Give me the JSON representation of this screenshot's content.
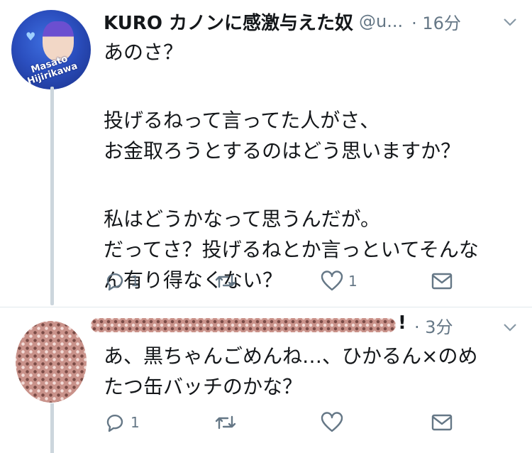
{
  "tweet1": {
    "author_name": "KURO カノンに感激与えた奴",
    "handle": "@u...",
    "time": "· 16分",
    "avatar_caption": "Masato Hijirikawa",
    "lines": [
      "あのさ？",
      "",
      "投げるねって言ってた人がさ、",
      "お金取ろうとするのはどう思いますか？",
      "",
      "私はどうかなって思うんだが。",
      "だってさ？投げるねとか言っといてそんな",
      "ん有り得なくない？"
    ],
    "actions": {
      "reply_count": "1",
      "retweet_count": "",
      "like_count": "1"
    }
  },
  "tweet2": {
    "author_suffix": "!",
    "time": "· 3分",
    "lines": [
      "あ、黒ちゃんごめんね…、ひかるん×のめ",
      "たつ缶バッチのかな？"
    ],
    "actions": {
      "reply_count": "1",
      "retweet_count": "",
      "like_count": ""
    }
  },
  "icons": [
    "reply-icon",
    "retweet-icon",
    "like-icon",
    "dm-icon",
    "chevron-down-icon"
  ],
  "colors": {
    "text": "#14171a",
    "secondary": "#657786",
    "thread_line": "#ccd6dd"
  }
}
